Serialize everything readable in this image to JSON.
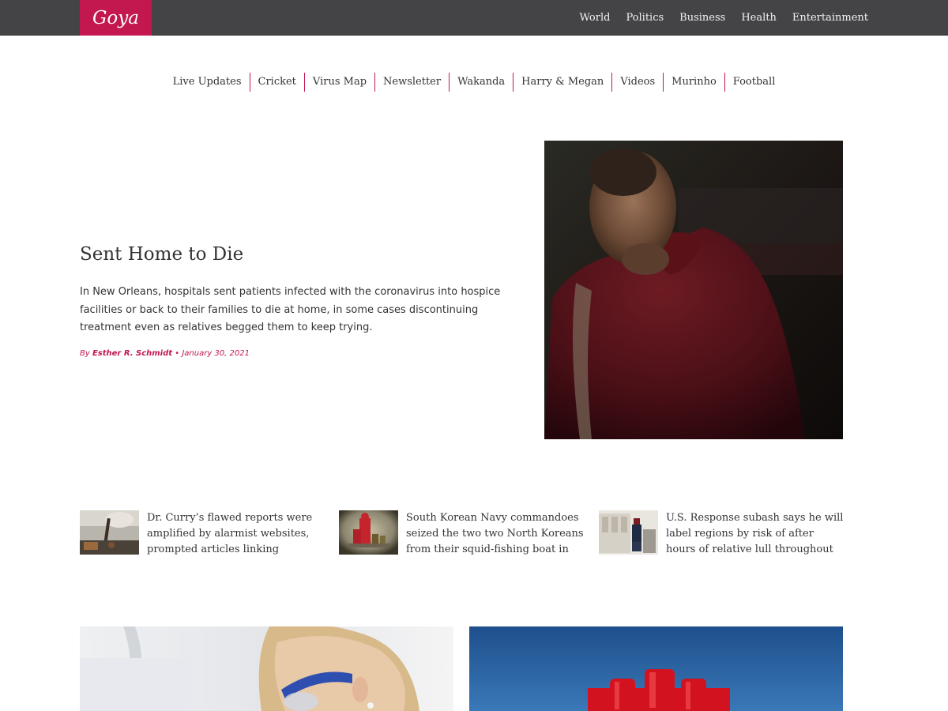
{
  "brand": {
    "logo": "Goya"
  },
  "topnav": [
    "World",
    "Politics",
    "Business",
    "Health",
    "Entertainment"
  ],
  "subnav": [
    "Live Updates",
    "Cricket",
    "Virus Map",
    "Newsletter",
    "Wakanda",
    "Harry & Megan",
    "Videos",
    "Murinho",
    "Football"
  ],
  "hero": {
    "title": "Sent Home to Die",
    "summary": "In New Orleans, hospitals sent patients infected with the coronavirus into hospice facilities or back to their families to die at home, in some cases discontinuing treatment even as relatives begged them to keep trying.",
    "by": "By",
    "author": "Esther R. Schmidt",
    "separator": "•",
    "date": "January 30, 2021"
  },
  "stories": [
    {
      "text": "Dr. Curry’s flawed reports were amplified by alarmist websites, prompted articles linking"
    },
    {
      "text": "South Korean Navy commandoes seized the two two North Koreans from their squid-fishing boat in early"
    },
    {
      "text": "U.S. Response subash says he will label regions by risk of after hours of relative lull throughout Thursday..."
    }
  ],
  "colors": {
    "accent": "#c2174f",
    "topbar": "#444446",
    "text": "#333333"
  }
}
